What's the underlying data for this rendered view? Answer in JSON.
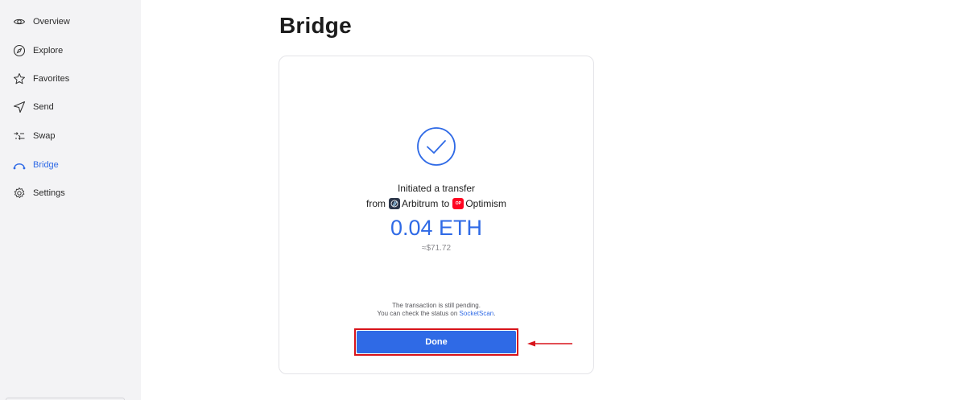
{
  "sidebar": {
    "items": [
      {
        "label": "Overview",
        "icon": "eye-icon"
      },
      {
        "label": "Explore",
        "icon": "compass-icon"
      },
      {
        "label": "Favorites",
        "icon": "star-icon"
      },
      {
        "label": "Send",
        "icon": "send-icon"
      },
      {
        "label": "Swap",
        "icon": "swap-icon"
      },
      {
        "label": "Bridge",
        "icon": "bridge-icon"
      },
      {
        "label": "Settings",
        "icon": "gear-icon"
      }
    ],
    "active": "Bridge"
  },
  "main": {
    "title": "Bridge",
    "card": {
      "status_text": "Initiated a transfer",
      "from_word": "from",
      "from_chain": "Arbitrum",
      "to_word": "to",
      "to_chain": "Optimism",
      "to_chain_badge": "OP",
      "amount": "0.04 ETH",
      "usd_value": "≈$71.72",
      "pending_line1": "The transaction is still pending.",
      "pending_line2_prefix": "You can check the status on",
      "pending_link": "SocketScan",
      "pending_suffix": ".",
      "done_label": "Done"
    }
  },
  "colors": {
    "accent": "#2f6ae6",
    "highlight": "#d8141b",
    "sidebar_bg": "#f3f3f5"
  }
}
